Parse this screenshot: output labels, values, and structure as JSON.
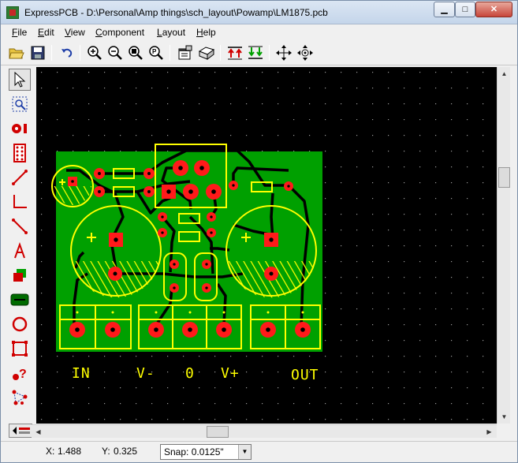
{
  "window": {
    "app_name": "ExpressPCB",
    "title": "ExpressPCB - D:\\Personal\\Amp things\\sch_layout\\Powamp\\LM1875.pcb",
    "controls": {
      "minimize": "▁",
      "maximize": "□",
      "close": "✕"
    }
  },
  "menu": [
    {
      "label": "File",
      "mnemonic": "F",
      "rest": "ile"
    },
    {
      "label": "Edit",
      "mnemonic": "E",
      "rest": "dit"
    },
    {
      "label": "View",
      "mnemonic": "V",
      "rest": "iew"
    },
    {
      "label": "Component",
      "mnemonic": "C",
      "rest": "omponent"
    },
    {
      "label": "Layout",
      "mnemonic": "L",
      "rest": "ayout"
    },
    {
      "label": "Help",
      "mnemonic": "H",
      "rest": "elp"
    }
  ],
  "toolbar": {
    "buttons": [
      "open-icon",
      "save-icon",
      "undo-icon",
      "zoom-in-icon",
      "zoom-out-icon",
      "zoom-window-icon",
      "zoom-fit-icon",
      "properties-icon",
      "order-icon",
      "top-layer-icon",
      "bottom-layer-icon",
      "pan-icon",
      "center-icon"
    ]
  },
  "tools": [
    "select-arrow-icon",
    "zoom-select-icon",
    "place-pad-icon",
    "place-component-icon",
    "draw-trace-icon",
    "draw-corner-trace-icon",
    "draw-line-icon",
    "place-text-icon",
    "place-fill-icon",
    "ground-plane-icon",
    "place-circle-icon",
    "place-rectangle-icon",
    "help-pad-icon",
    "netlist-icon"
  ],
  "board": {
    "labels": [
      "IN",
      "V-",
      "0",
      "V+",
      "OUT"
    ],
    "colors": {
      "background": "#000000",
      "board": "#00a000",
      "copper": "#000000",
      "pad": "#ff0000",
      "silkscreen": "#ffff00"
    }
  },
  "layer_tabs": [
    "top-layer-tab",
    "bottom-layer-tab"
  ],
  "status": {
    "x_label": "X:",
    "x_value": "1.488",
    "y_label": "Y:",
    "y_value": "0.325",
    "snap_label": "Snap:",
    "snap_value": "0.0125\""
  }
}
